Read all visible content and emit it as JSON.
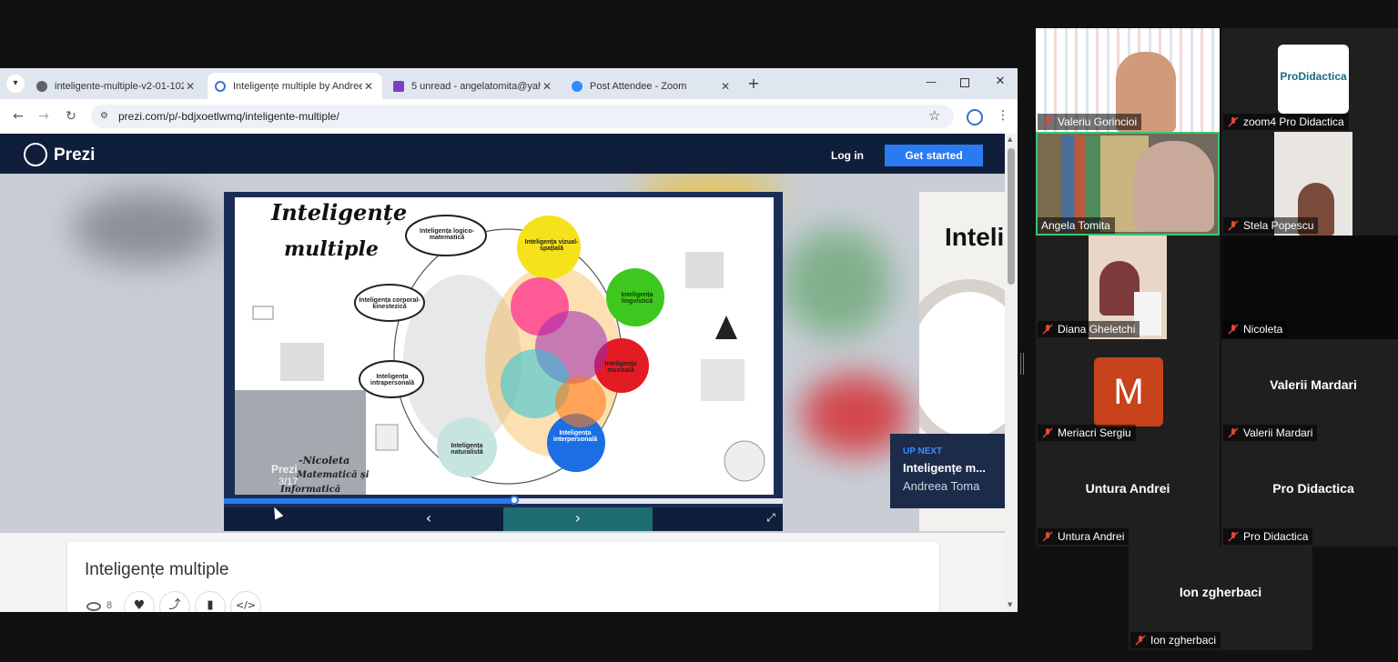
{
  "browser": {
    "tabs": [
      {
        "label": "inteligente-multiple-v2-01-102",
        "favicon_color": "#5f6368",
        "active": false
      },
      {
        "label": "Inteligențe multiple by Andreea",
        "favicon_color": "#3b6fd4",
        "active": true
      },
      {
        "label": "5 unread - angelatomita@yaho",
        "favicon_color": "#7b3fc7",
        "active": false
      },
      {
        "label": "Post Attendee - Zoom",
        "favicon_color": "#2d8cff",
        "active": false
      }
    ],
    "new_tab": "+",
    "url": "prezi.com/p/-bdjxoetlwmq/inteligente-multiple/"
  },
  "prezi": {
    "logo": "Prezi",
    "login": "Log in",
    "get_started": "Get started",
    "brand_color": "#2a7af2",
    "slide": {
      "title_line1": "Inteligențe",
      "title_line2": "multiple",
      "nodes": [
        "Inteligența logico-matematică",
        "Inteligența vizual-spațială",
        "Inteligența lingvistică",
        "Inteligența corporal-kinestezică",
        "Inteligența muzicală",
        "Inteligența intrapersonală",
        "Inteligența naturalistă",
        "Inteligența interpersonală"
      ],
      "author_line1": "-Nicoleta",
      "author_line2": "Matematică și",
      "author_line3": "Informatică",
      "progress": 0.52
    },
    "page_indicator": "3/17",
    "watermark": "Prezi",
    "next_preview_text": "Inteli",
    "up_next": {
      "label": "UP NEXT",
      "title": "Inteligențe m...",
      "author": "Andreea Toma"
    },
    "info_title": "Inteligențe multiple",
    "views": "8"
  },
  "zoom": {
    "participants": [
      {
        "name": "Valeriu Gorincioi",
        "type": "video"
      },
      {
        "name": "zoom4 Pro Didactica",
        "type": "logo",
        "logo_text": "ProDidactica"
      },
      {
        "name": "Angela Tomita",
        "type": "video",
        "speaking": true
      },
      {
        "name": "Stela Popescu",
        "type": "video"
      },
      {
        "name": "Diana Gheletchi",
        "type": "video"
      },
      {
        "name": "Nicoleta",
        "type": "blank"
      },
      {
        "name": "Meriacri Sergiu",
        "type": "avatar",
        "initial": "M",
        "avatar_color": "#c8431b"
      },
      {
        "name": "Valerii Mardari",
        "type": "name",
        "big_name": "Valerii Mardari"
      },
      {
        "name": "Untura Andrei",
        "type": "name",
        "big_name": "Untura Andrei"
      },
      {
        "name": "Pro Didactica",
        "type": "name",
        "big_name": "Pro Didactica"
      },
      {
        "name": "Ion zgherbaci",
        "type": "name",
        "big_name": "Ion zgherbaci"
      }
    ],
    "muted_color": "#e0463a",
    "speaker_border": "#3ec56f"
  }
}
